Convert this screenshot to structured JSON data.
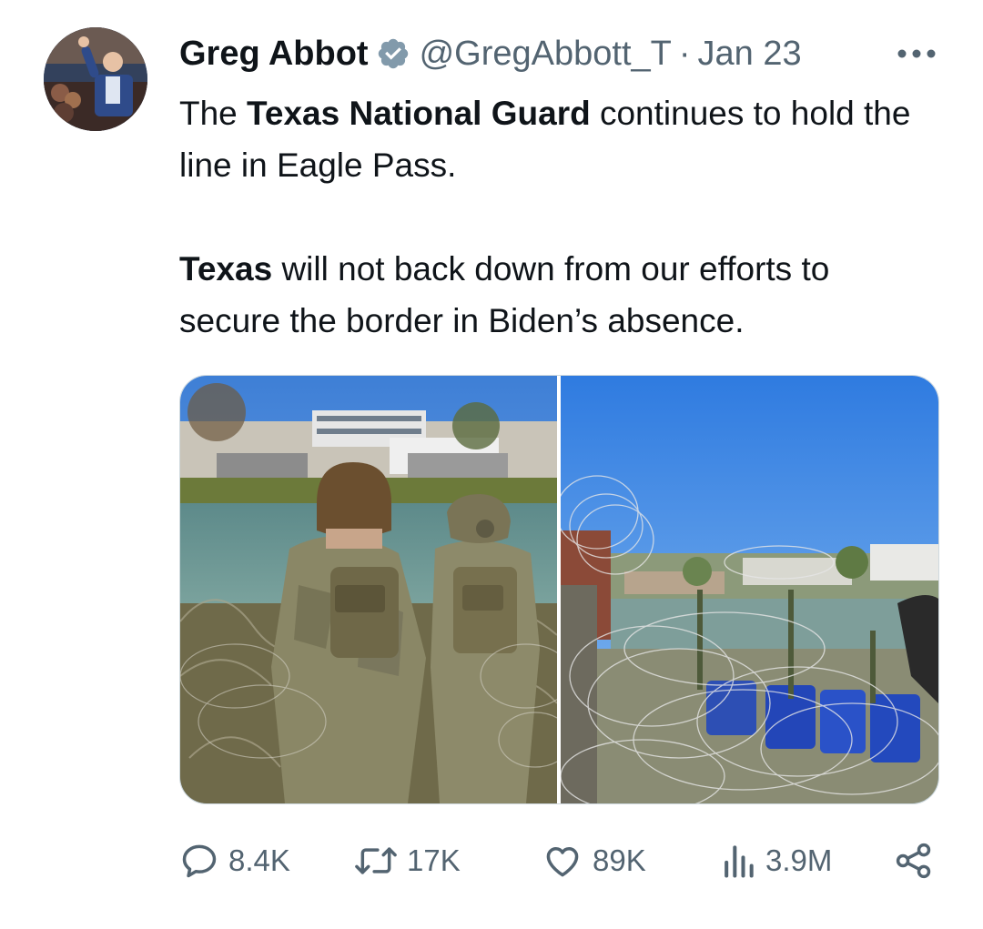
{
  "author": {
    "display_name": "Greg Abbot",
    "handle": "@GregAbbott_T",
    "separator": "·",
    "date": "Jan 23",
    "verified": true
  },
  "tweet": {
    "line1_pre": "The ",
    "line1_bold": "Texas National Guard",
    "line1_post": " continues to hold the line in Eagle Pass.",
    "line2_bold": "Texas",
    "line2_post": " will not back down from our efforts to secure the border in Biden’s absence."
  },
  "actions": {
    "replies": "8.4K",
    "reposts": "17K",
    "likes": "89K",
    "views": "3.9M"
  },
  "colors": {
    "text": "#0f1419",
    "secondary": "#536471",
    "verified_badge": "#829aab",
    "media_border": "#cfd9de"
  },
  "icons": {
    "more": "more-icon",
    "reply": "reply-icon",
    "repost": "repost-icon",
    "like": "like-icon",
    "views": "views-icon",
    "share": "share-icon"
  }
}
